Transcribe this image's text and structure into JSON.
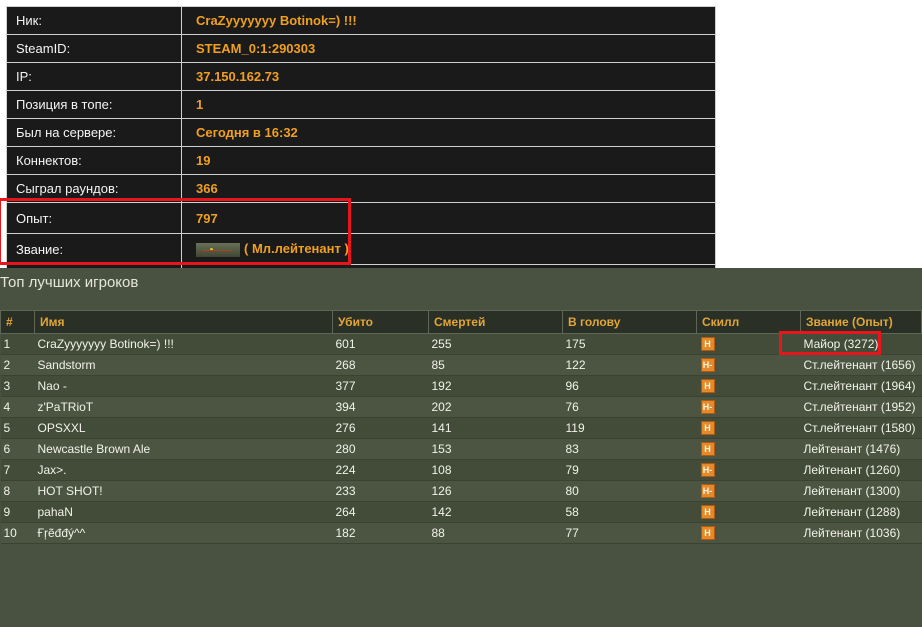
{
  "player": {
    "rows": [
      {
        "label": "Ник:",
        "value": "CraZyyyyyyy Botinok=) !!!"
      },
      {
        "label": "SteamID:",
        "value": "STEAM_0:1:290303"
      },
      {
        "label": "IP:",
        "value": "37.150.162.73"
      },
      {
        "label": "Позиция в топе:",
        "value": "1"
      },
      {
        "label": "Был на сервере:",
        "value": "Сегодня в 16:32"
      },
      {
        "label": "Коннектов:",
        "value": "19"
      },
      {
        "label": "Сыграл раундов:",
        "value": "366"
      },
      {
        "label": "Опыт:",
        "value": "797"
      },
      {
        "label": "Звание:",
        "value": "( Мл.лейтенант )"
      }
    ],
    "rank_badge_icon": "rank-insignia-icon"
  },
  "top": {
    "title": "Топ лучших игроков",
    "headers": [
      "#",
      "Имя",
      "Убито",
      "Смертей",
      "В голову",
      "Скилл",
      "Звание (Опыт)"
    ],
    "skill_icon": "skill-letter-icon",
    "rows": [
      {
        "num": "1",
        "name": "CraZyyyyyyy Botinok=) !!!",
        "kills": "601",
        "deaths": "255",
        "hs": "175",
        "skill": "H",
        "rank": "Майор (3272)"
      },
      {
        "num": "2",
        "name": "Sandstorm",
        "kills": "268",
        "deaths": "85",
        "hs": "122",
        "skill": "H-",
        "rank": "Ст.лейтенант (1656)"
      },
      {
        "num": "3",
        "name": "Nao -",
        "kills": "377",
        "deaths": "192",
        "hs": "96",
        "skill": "H",
        "rank": "Ст.лейтенант (1964)"
      },
      {
        "num": "4",
        "name": "z'PaTRioT",
        "kills": "394",
        "deaths": "202",
        "hs": "76",
        "skill": "H-",
        "rank": "Ст.лейтенант (1952)"
      },
      {
        "num": "5",
        "name": "OPSXXL",
        "kills": "276",
        "deaths": "141",
        "hs": "119",
        "skill": "H",
        "rank": "Ст.лейтенант (1580)"
      },
      {
        "num": "6",
        "name": "Newcastle Brown Ale",
        "kills": "280",
        "deaths": "153",
        "hs": "83",
        "skill": "H",
        "rank": "Лейтенант (1476)"
      },
      {
        "num": "7",
        "name": "Jax>.",
        "kills": "224",
        "deaths": "108",
        "hs": "79",
        "skill": "H-",
        "rank": "Лейтенант (1260)"
      },
      {
        "num": "8",
        "name": "HOT SHOT!",
        "kills": "233",
        "deaths": "126",
        "hs": "80",
        "skill": "H-",
        "rank": "Лейтенант (1300)"
      },
      {
        "num": "9",
        "name": "pahaN",
        "kills": "264",
        "deaths": "142",
        "hs": "58",
        "skill": "H",
        "rank": "Лейтенант (1288)"
      },
      {
        "num": "10",
        "name": "Ғŗẽđđý^^",
        "kills": "182",
        "deaths": "88",
        "hs": "77",
        "skill": "H",
        "rank": "Лейтенант (1036)"
      }
    ]
  },
  "colors": {
    "highlight": "#e8161c",
    "accent": "#f0a020"
  }
}
